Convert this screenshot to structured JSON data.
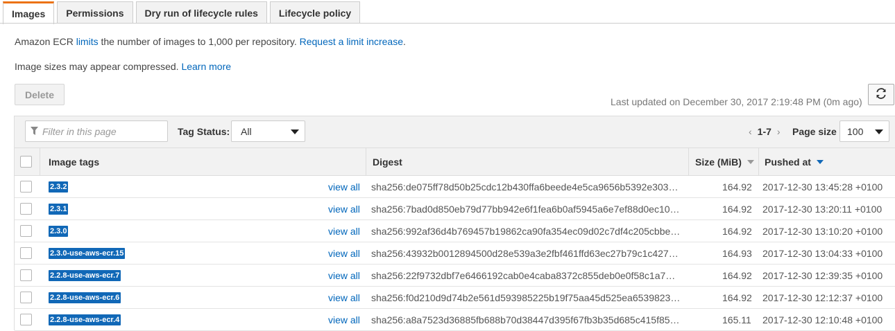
{
  "tabs": [
    {
      "label": "Images",
      "active": true
    },
    {
      "label": "Permissions",
      "active": false
    },
    {
      "label": "Dry run of lifecycle rules",
      "active": false
    },
    {
      "label": "Lifecycle policy",
      "active": false
    }
  ],
  "info": {
    "line1_prefix": "Amazon ECR ",
    "line1_link": "limits",
    "line1_mid": " the number of images to 1,000 per repository. ",
    "line1_link2": "Request a limit increase",
    "line1_suffix": ".",
    "line2_text": "Image sizes may appear compressed. ",
    "line2_link": "Learn more"
  },
  "toolbar": {
    "delete_label": "Delete",
    "last_updated": "Last updated on December 30, 2017 2:19:48 PM (0m ago)",
    "filter_placeholder": "Filter in this page",
    "tag_status_label": "Tag Status:",
    "tag_status_value": "All",
    "pager_prev": "‹",
    "pager_range": "1-7",
    "pager_next": "›",
    "page_size_label": "Page size",
    "page_size_value": "100"
  },
  "table": {
    "columns": {
      "image_tags": "Image tags",
      "digest": "Digest",
      "size": "Size (MiB)",
      "pushed_at": "Pushed at"
    },
    "rows": [
      {
        "tag": "2.3.2",
        "link": "view all",
        "digest": "sha256:de075ff78d50b25cdc12b430ffa6beede4e5ca9656b5392e303…",
        "size": "164.92",
        "pushed": "2017-12-30 13:45:28 +0100"
      },
      {
        "tag": "2.3.1",
        "link": "view all",
        "digest": "sha256:7bad0d850eb79d77bb942e6f1fea6b0af5945a6e7ef88d0ec10…",
        "size": "164.92",
        "pushed": "2017-12-30 13:20:11 +0100"
      },
      {
        "tag": "2.3.0",
        "link": "view all",
        "digest": "sha256:992af36d4b769457b19862ca90fa354ec09d02c7df4c205cbbe…",
        "size": "164.92",
        "pushed": "2017-12-30 13:10:20 +0100"
      },
      {
        "tag": "2.3.0-use-aws-ecr.15",
        "link": "view all",
        "digest": "sha256:43932b0012894500d28e539a3e2fbf461ffd63ec27b79c1c427…",
        "size": "164.93",
        "pushed": "2017-12-30 13:04:33 +0100"
      },
      {
        "tag": "2.2.8-use-aws-ecr.7",
        "link": "view all",
        "digest": "sha256:22f9732dbf7e6466192cab0e4caba8372c855deb0e0f58c1a79…",
        "size": "164.92",
        "pushed": "2017-12-30 12:39:35 +0100"
      },
      {
        "tag": "2.2.8-use-aws-ecr.6",
        "link": "view all",
        "digest": "sha256:f0d210d9d74b2e561d593985225b19f75aa45d525ea6539823…",
        "size": "164.92",
        "pushed": "2017-12-30 12:12:37 +0100"
      },
      {
        "tag": "2.2.8-use-aws-ecr.4",
        "link": "view all",
        "digest": "sha256:a8a7523d36885fb688b70d38447d395f67fb3b35d685c415f85…",
        "size": "165.11",
        "pushed": "2017-12-30 12:10:48 +0100"
      }
    ]
  },
  "colors": {
    "accent_tab": "#ec7211",
    "link": "#0066bb",
    "tag_badge": "#1168b7",
    "sort_active": "#1168b7",
    "sort_inactive": "#999999"
  },
  "icons": {
    "filter": "filter-funnel-icon",
    "refresh": "refresh-icon",
    "sort": "sort-caret-icon",
    "dropdown": "chevron-down-icon"
  }
}
